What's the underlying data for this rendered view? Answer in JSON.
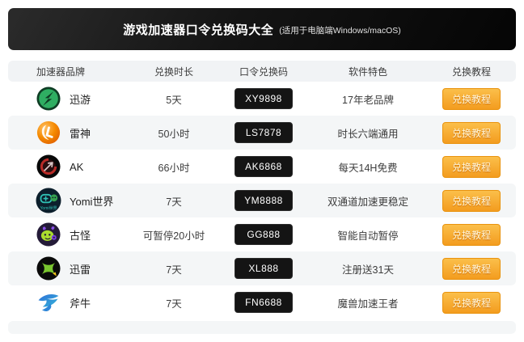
{
  "banner": {
    "title": "游戏加速器口令兑换码大全",
    "subtitle": "(适用于电脑端Windows/macOS)"
  },
  "table": {
    "columns": [
      "加速器品牌",
      "兑换时长",
      "口令兑换码",
      "软件特色",
      "兑换教程"
    ],
    "rows": [
      {
        "brand": "迅游",
        "logo": "xunyou-logo",
        "duration": "5天",
        "code": "XY9898",
        "feature": "17年老品牌",
        "action": "兑换教程"
      },
      {
        "brand": "雷神",
        "logo": "leishen-logo",
        "duration": "50小时",
        "code": "LS7878",
        "feature": "时长六端通用",
        "action": "兑换教程"
      },
      {
        "brand": "AK",
        "logo": "ak-logo",
        "duration": "66小时",
        "code": "AK6868",
        "feature": "每天14H免费",
        "action": "兑换教程"
      },
      {
        "brand": "Yomi世界",
        "logo": "yomi-logo",
        "duration": "7天",
        "code": "YM8888",
        "feature": "双通道加速更稳定",
        "action": "兑换教程"
      },
      {
        "brand": "古怪",
        "logo": "guguai-logo",
        "duration": "可暂停20小时",
        "code": "GG888",
        "feature": "智能自动暂停",
        "action": "兑换教程"
      },
      {
        "brand": "迅雷",
        "logo": "xunlei-logo",
        "duration": "7天",
        "code": "XL888",
        "feature": "注册送31天",
        "action": "兑换教程"
      },
      {
        "brand": "斧牛",
        "logo": "funiu-logo",
        "duration": "7天",
        "code": "FN6688",
        "feature": "魔兽加速王者",
        "action": "兑换教程"
      }
    ]
  },
  "colors": {
    "banner_bg": "#141414",
    "badge_bg": "#141414",
    "accent_orange": "#f39c1f",
    "row_alt_bg": "#f4f6f7"
  }
}
